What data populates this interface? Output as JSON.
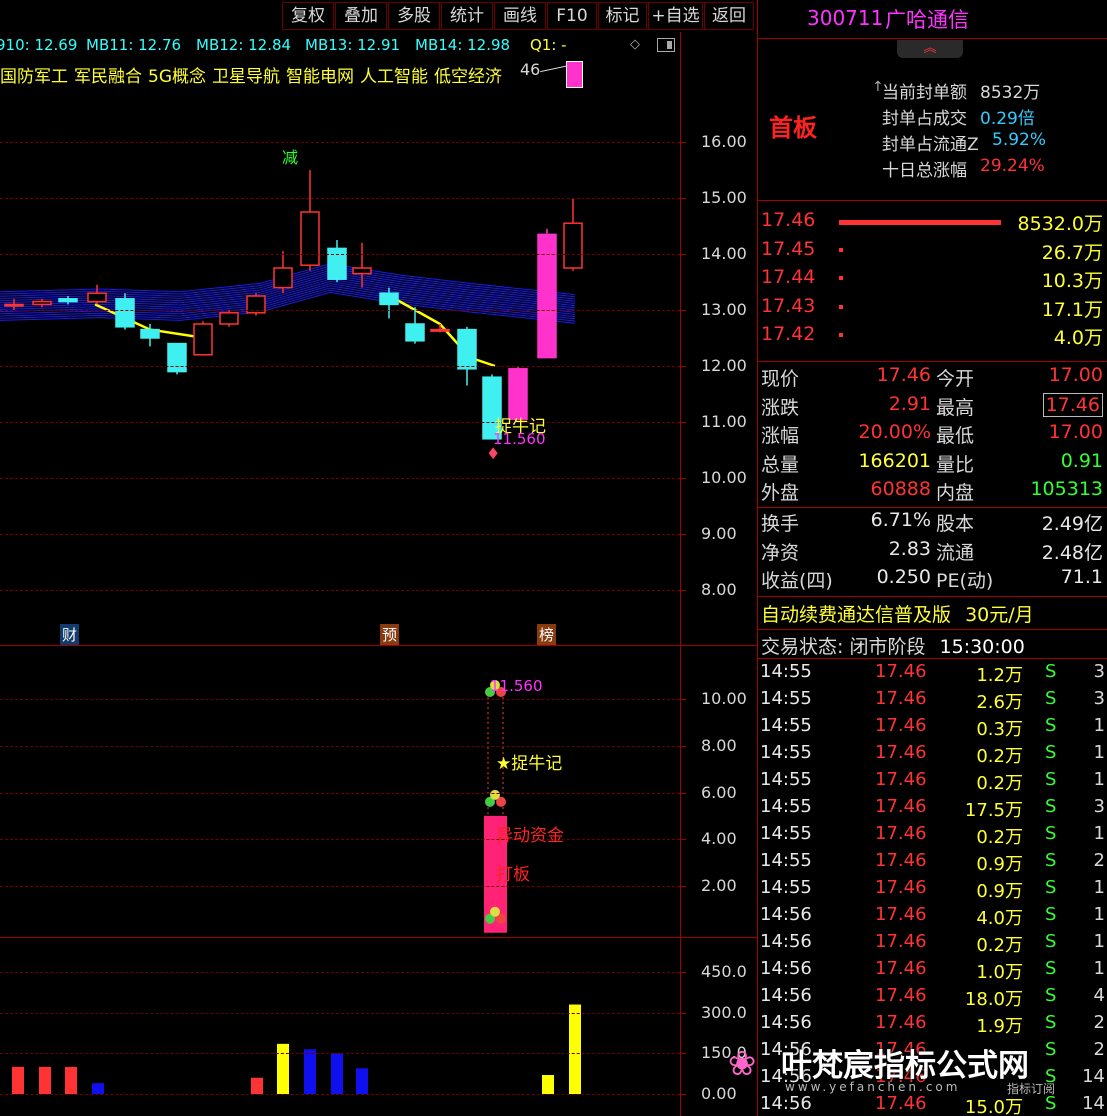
{
  "toolbar": {
    "buttons": [
      "复权",
      "叠加",
      "多股",
      "统计",
      "画线",
      "F10",
      "标记",
      "+自选",
      "返回"
    ]
  },
  "ma_line": {
    "items": [
      "910: 12.69",
      "MB11: 12.76",
      "MB12: 12.84",
      "MB13: 12.91",
      "MB14: 12.98"
    ],
    "q1": "Q1: -"
  },
  "concepts": [
    "国防军工",
    "军民融合",
    "5G概念",
    "卫星导航",
    "智能电网",
    "人工智能",
    "低空经济"
  ],
  "annotations": {
    "top_price_tag": "46",
    "jian": "减",
    "zhuoniuji": "捉牛记",
    "low_price": "11.560",
    "cai": "财",
    "yu": "预",
    "bang": "榜",
    "sub_high": "11.560",
    "sub_zhuoniuji": "★捉牛记",
    "sub_yidong": "异动资金",
    "sub_daban": "打板"
  },
  "axes": {
    "main_ticks": [
      "16.00",
      "15.00",
      "14.00",
      "13.00",
      "12.00",
      "11.00",
      "10.00",
      "9.00",
      "8.00"
    ],
    "sub_ticks": [
      "10.00",
      "8.00",
      "6.00",
      "4.00",
      "2.00"
    ],
    "vol_ticks": [
      "450.0",
      "300.0",
      "150.0",
      "0.00"
    ]
  },
  "chart_data": {
    "type": "bar",
    "candles": [
      {
        "o": 13.1,
        "c": 13.1,
        "h": 13.2,
        "l": 13.0,
        "color": "red"
      },
      {
        "o": 13.1,
        "c": 13.15,
        "h": 13.2,
        "l": 13.05,
        "color": "red"
      },
      {
        "o": 13.15,
        "c": 13.2,
        "h": 13.25,
        "l": 13.1,
        "color": "cyan"
      },
      {
        "o": 13.15,
        "c": 13.3,
        "h": 13.45,
        "l": 13.1,
        "color": "red"
      },
      {
        "o": 13.2,
        "c": 12.7,
        "h": 13.3,
        "l": 12.65,
        "color": "cyan"
      },
      {
        "o": 12.65,
        "c": 12.5,
        "h": 12.75,
        "l": 12.35,
        "color": "cyan"
      },
      {
        "o": 12.4,
        "c": 11.9,
        "h": 12.4,
        "l": 11.85,
        "color": "cyan"
      },
      {
        "o": 12.2,
        "c": 12.75,
        "h": 12.8,
        "l": 12.2,
        "color": "red"
      },
      {
        "o": 12.75,
        "c": 12.95,
        "h": 13.0,
        "l": 12.7,
        "color": "red"
      },
      {
        "o": 12.95,
        "c": 13.25,
        "h": 13.3,
        "l": 12.9,
        "color": "red"
      },
      {
        "o": 13.4,
        "c": 13.75,
        "h": 14.05,
        "l": 13.3,
        "color": "red"
      },
      {
        "o": 13.8,
        "c": 14.75,
        "h": 15.5,
        "l": 13.7,
        "color": "red"
      },
      {
        "o": 14.1,
        "c": 13.55,
        "h": 14.25,
        "l": 13.5,
        "color": "cyan"
      },
      {
        "o": 13.65,
        "c": 13.75,
        "h": 14.2,
        "l": 13.4,
        "color": "red"
      },
      {
        "o": 13.3,
        "c": 13.1,
        "h": 13.4,
        "l": 12.85,
        "color": "cyan"
      },
      {
        "o": 12.75,
        "c": 12.45,
        "h": 13.05,
        "l": 12.4,
        "color": "cyan"
      },
      {
        "o": 12.65,
        "c": 12.65,
        "h": 12.75,
        "l": 12.6,
        "color": "red"
      },
      {
        "o": 12.65,
        "c": 11.95,
        "h": 12.7,
        "l": 11.65,
        "color": "cyan"
      },
      {
        "o": 11.8,
        "c": 10.7,
        "h": 11.85,
        "l": 10.7,
        "color": "cyan"
      },
      {
        "o": 11.95,
        "c": 11.05,
        "h": 12.0,
        "l": 11.05,
        "color": "magenta"
      },
      {
        "o": 12.15,
        "c": 14.35,
        "h": 14.45,
        "l": 12.15,
        "color": "magenta"
      },
      {
        "o": 13.75,
        "c": 14.55,
        "h": 15.0,
        "l": 13.7,
        "color": "red"
      }
    ],
    "sub_bar": {
      "low": 0,
      "high": 5.0
    },
    "volume": [
      {
        "v": 100,
        "color": "red"
      },
      {
        "v": 100,
        "color": "red"
      },
      {
        "v": 100,
        "color": "red"
      },
      {
        "v": 40,
        "color": "blue"
      },
      {
        "v": 60,
        "color": "red"
      },
      {
        "v": 185,
        "color": "yellow"
      },
      {
        "v": 165,
        "color": "blue"
      },
      {
        "v": 150,
        "color": "blue"
      },
      {
        "v": 95,
        "color": "blue"
      },
      {
        "v": 70,
        "color": "yellow"
      },
      {
        "v": 330,
        "color": "yellow"
      }
    ],
    "ylim_main": [
      7.5,
      17.0
    ],
    "ylim_sub": [
      0,
      11.5
    ],
    "ylim_vol": [
      0,
      500
    ]
  },
  "stock": {
    "code": "300711",
    "name": "广哈通信",
    "tag": "首板",
    "seal_amount_label": "当前封单额",
    "seal_amount": "8532万",
    "seal_turnover_label": "封单占成交",
    "seal_turnover": "0.29倍",
    "seal_float_label": "封单占流通Z",
    "seal_float": "5.92%",
    "ten_day_label": "十日总涨幅",
    "ten_day": "29.24%"
  },
  "bids": [
    {
      "price": "17.46",
      "vol": "8532.0万"
    },
    {
      "price": "17.45",
      "vol": "26.7万"
    },
    {
      "price": "17.44",
      "vol": "10.3万"
    },
    {
      "price": "17.43",
      "vol": "17.1万"
    },
    {
      "price": "17.42",
      "vol": "4.0万"
    }
  ],
  "quote": [
    {
      "l1": "现价",
      "v1": "17.46",
      "c1": "red",
      "l2": "今开",
      "v2": "17.00",
      "c2": "red"
    },
    {
      "l1": "涨跌",
      "v1": "2.91",
      "c1": "red",
      "l2": "最高",
      "v2": "17.46",
      "c2": "red"
    },
    {
      "l1": "涨幅",
      "v1": "20.00%",
      "c1": "red",
      "l2": "最低",
      "v2": "17.00",
      "c2": "red"
    },
    {
      "l1": "总量",
      "v1": "166201",
      "c1": "yel",
      "l2": "量比",
      "v2": "0.91",
      "c2": "grn"
    },
    {
      "l1": "外盘",
      "v1": "60888",
      "c1": "red",
      "l2": "内盘",
      "v2": "105313",
      "c2": "grn"
    }
  ],
  "fundamentals": [
    {
      "l1": "换手",
      "v1": "6.71%",
      "l2": "股本",
      "v2": "2.49亿"
    },
    {
      "l1": "净资",
      "v1": "2.83",
      "l2": "流通",
      "v2": "2.48亿"
    },
    {
      "l1": "收益(四)",
      "v1": "0.250",
      "l2": "PE(动)",
      "v2": "71.1"
    }
  ],
  "promo": {
    "text": "自动续费通达信普及版",
    "price": "30元/月"
  },
  "status": {
    "label": "交易状态:",
    "value": "闭市阶段",
    "time": "15:30:00"
  },
  "trades": [
    {
      "t": "14:55",
      "p": "17.46",
      "v": "1.2万",
      "s": "S",
      "n": "3"
    },
    {
      "t": "14:55",
      "p": "17.46",
      "v": "2.6万",
      "s": "S",
      "n": "3"
    },
    {
      "t": "14:55",
      "p": "17.46",
      "v": "0.3万",
      "s": "S",
      "n": "1"
    },
    {
      "t": "14:55",
      "p": "17.46",
      "v": "0.2万",
      "s": "S",
      "n": "1"
    },
    {
      "t": "14:55",
      "p": "17.46",
      "v": "0.2万",
      "s": "S",
      "n": "1"
    },
    {
      "t": "14:55",
      "p": "17.46",
      "v": "17.5万",
      "s": "S",
      "n": "3"
    },
    {
      "t": "14:55",
      "p": "17.46",
      "v": "0.2万",
      "s": "S",
      "n": "1"
    },
    {
      "t": "14:55",
      "p": "17.46",
      "v": "0.9万",
      "s": "S",
      "n": "2"
    },
    {
      "t": "14:55",
      "p": "17.46",
      "v": "0.9万",
      "s": "S",
      "n": "1"
    },
    {
      "t": "14:56",
      "p": "17.46",
      "v": "4.0万",
      "s": "S",
      "n": "1"
    },
    {
      "t": "14:56",
      "p": "17.46",
      "v": "0.2万",
      "s": "S",
      "n": "1"
    },
    {
      "t": "14:56",
      "p": "17.46",
      "v": "1.0万",
      "s": "S",
      "n": "1"
    },
    {
      "t": "14:56",
      "p": "17.46",
      "v": "18.0万",
      "s": "S",
      "n": "4"
    },
    {
      "t": "14:56",
      "p": "17.46",
      "v": "1.9万",
      "s": "S",
      "n": "2"
    },
    {
      "t": "14:56",
      "p": "17.46",
      "v": "",
      "s": "S",
      "n": "2"
    },
    {
      "t": "14:56",
      "p": "17.46",
      "v": "",
      "s": "S",
      "n": "14"
    },
    {
      "t": "14:56",
      "p": "17.46",
      "v": "15.0万",
      "s": "S",
      "n": "14"
    }
  ],
  "watermark": {
    "title": "叶梵宸指标公式网",
    "url": "www.yefanchen.com",
    "sub": "指标订阅"
  },
  "colors": {
    "red": "#ff3333",
    "cyan": "#40f0f0",
    "magenta": "#ff33cc",
    "yellow": "#ffff00",
    "blue": "#1010ee",
    "grid": "#a00000"
  }
}
